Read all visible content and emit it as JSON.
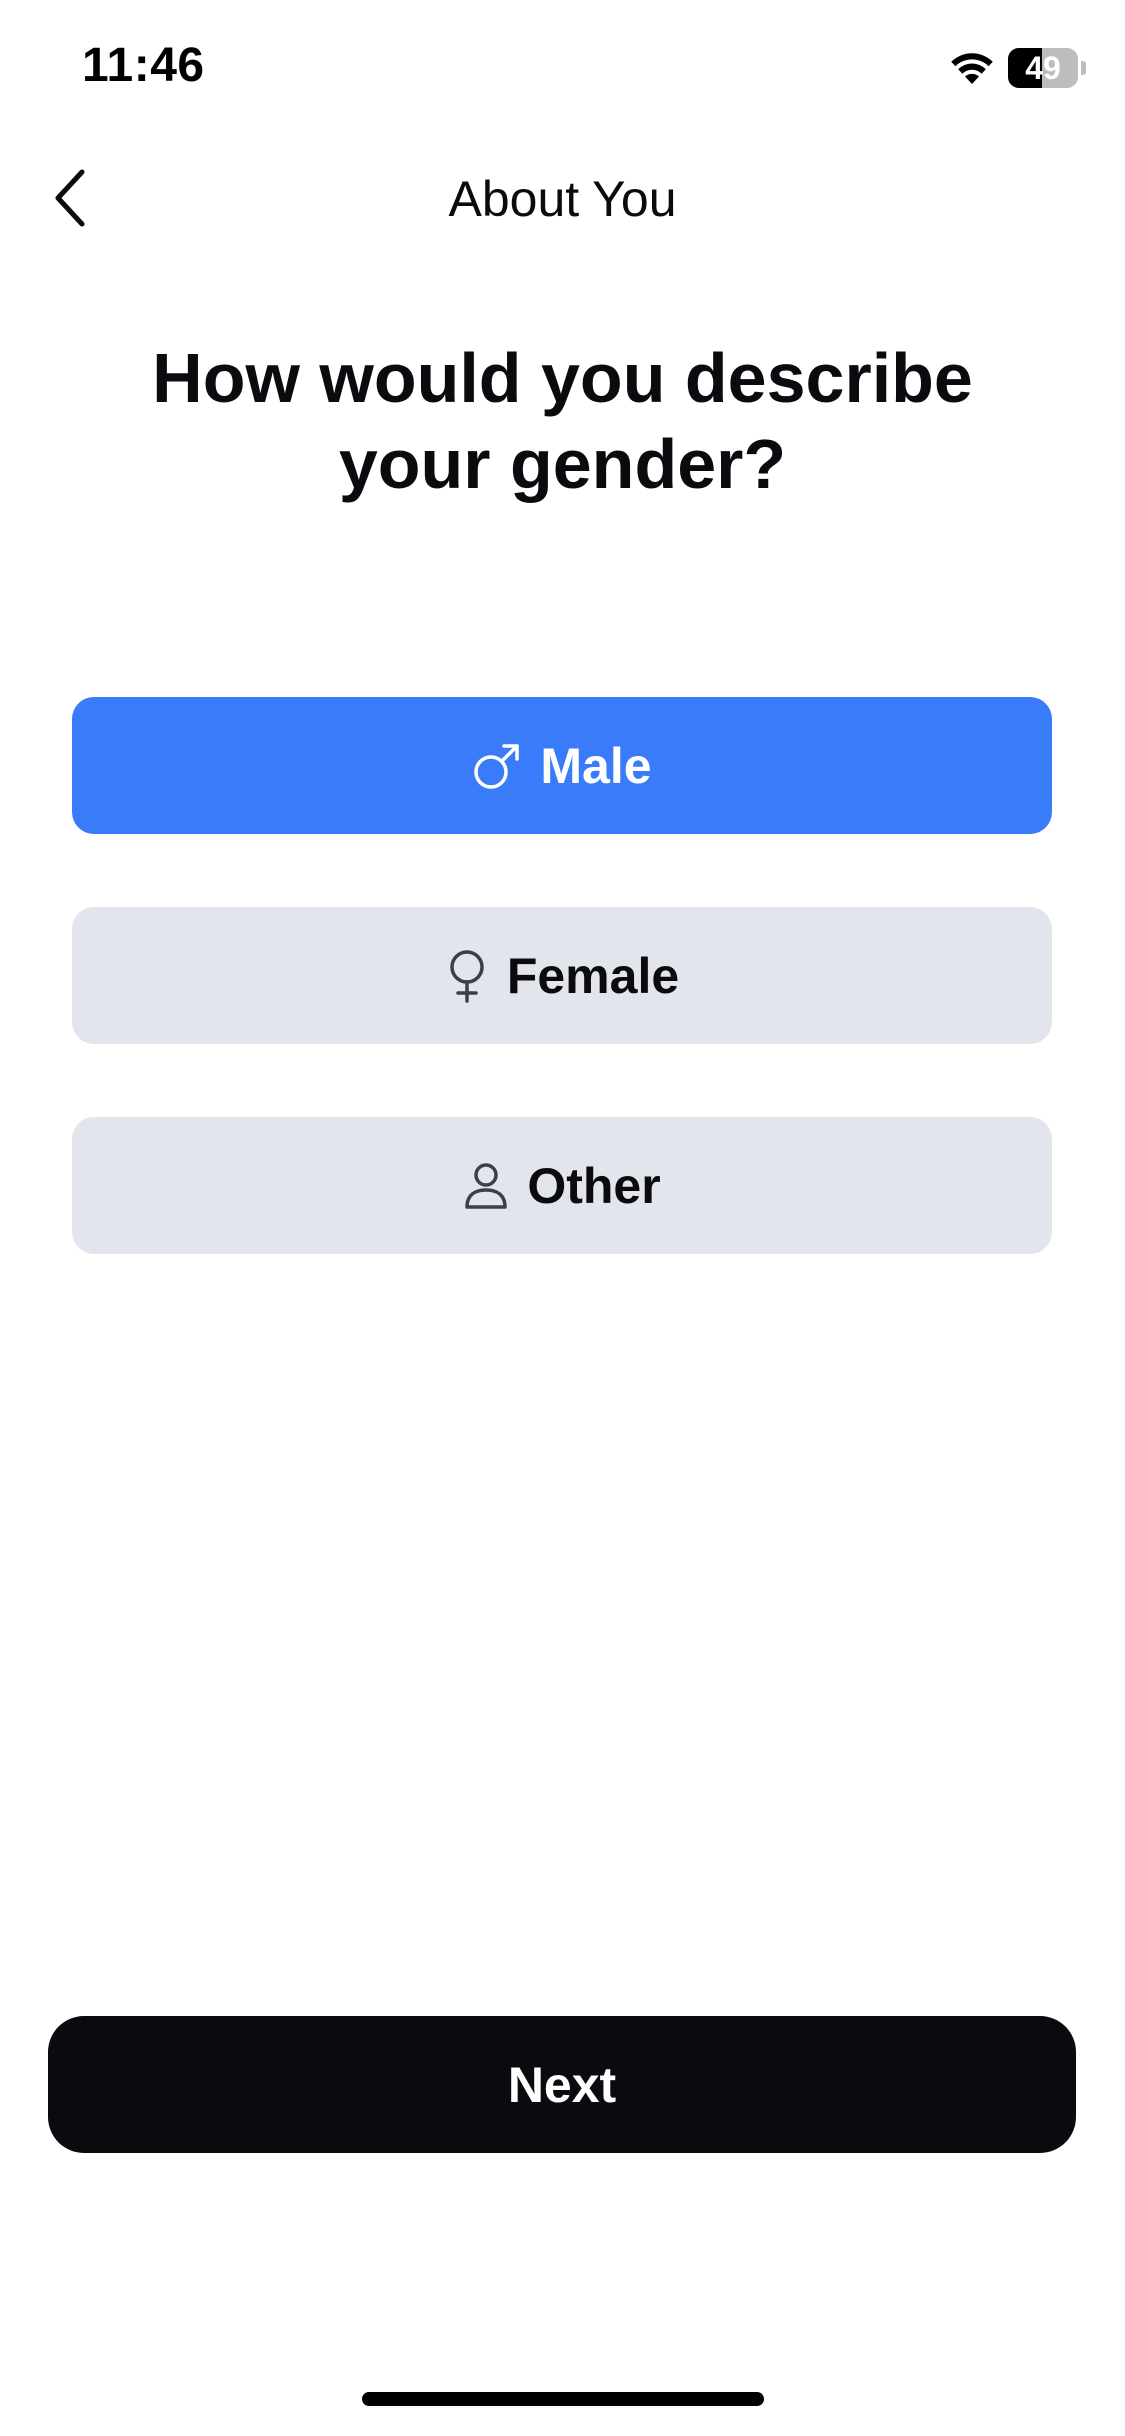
{
  "status_bar": {
    "time": "11:46",
    "battery_level": "49",
    "battery_fraction": 0.49,
    "icons": [
      "wifi-icon",
      "battery-icon"
    ]
  },
  "nav": {
    "title": "About You",
    "back_icon": "chevron-left-icon"
  },
  "question": "How would you describe your gender?",
  "options": [
    {
      "label": "Male",
      "icon": "male-symbol-icon",
      "selected": true
    },
    {
      "label": "Female",
      "icon": "female-symbol-icon",
      "selected": false
    },
    {
      "label": "Other",
      "icon": "person-icon",
      "selected": false
    }
  ],
  "next_button": {
    "label": "Next"
  },
  "colors": {
    "accent": "#3a7bfa",
    "option_bg": "#e2e6ec",
    "primary_button": "#0b0b0f",
    "text": "#0b0b0f",
    "background": "#ffffff"
  }
}
